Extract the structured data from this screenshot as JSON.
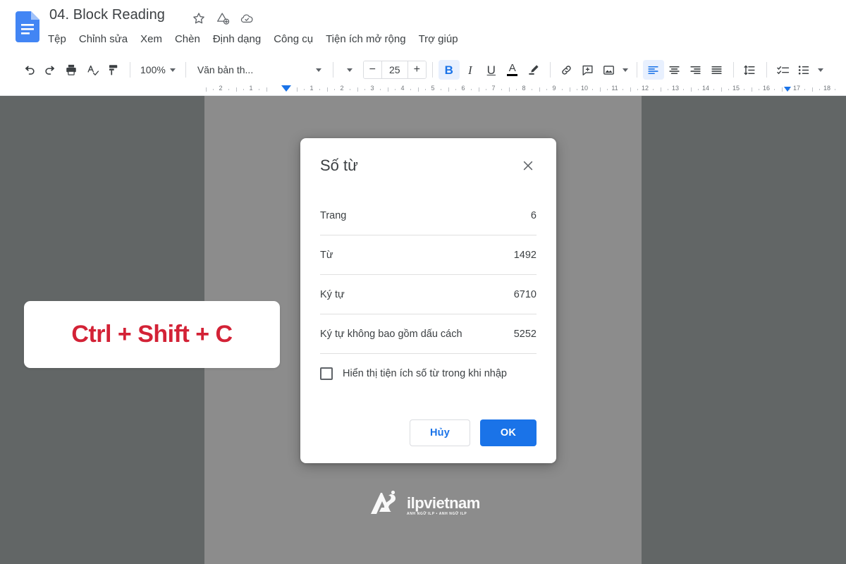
{
  "app": {
    "doc_title": "04. Block Reading",
    "doc_icon": "google-docs-icon"
  },
  "title_actions": [
    {
      "name": "star-icon",
      "label": "Gắn dấu sao"
    },
    {
      "name": "move-to-folder-icon",
      "label": "Di chuyển"
    },
    {
      "name": "cloud-saved-icon",
      "label": "Đã lưu vào Drive"
    }
  ],
  "menubar": {
    "items": [
      {
        "label": "Tệp"
      },
      {
        "label": "Chỉnh sửa"
      },
      {
        "label": "Xem"
      },
      {
        "label": "Chèn"
      },
      {
        "label": "Định dạng"
      },
      {
        "label": "Công cụ"
      },
      {
        "label": "Tiện ích mở rộng"
      },
      {
        "label": "Trợ giúp"
      }
    ]
  },
  "toolbar": {
    "zoom_level": "100%",
    "paragraph_style": "Văn bản th...",
    "font_size": "25",
    "decrease_label": "−",
    "increase_label": "+",
    "bold_label": "B",
    "italic_label": "I",
    "underline_label": "U",
    "text_color_label": "A",
    "icons": [
      "undo-icon",
      "redo-icon",
      "print-icon",
      "spellcheck-icon",
      "paint-format-icon",
      "insert-link-icon",
      "add-comment-icon",
      "insert-image-icon",
      "align-left-icon",
      "align-center-icon",
      "align-right-icon",
      "align-justify-icon",
      "line-spacing-icon",
      "checklist-icon",
      "bulleted-list-icon",
      "highlight-color-icon"
    ],
    "active": [
      "bold",
      "align-left"
    ]
  },
  "ruler": {
    "left_numbers": [
      "2",
      "1"
    ],
    "numbers": [
      "1",
      "2",
      "3",
      "4",
      "5",
      "6",
      "7",
      "8",
      "9",
      "10",
      "11",
      "12",
      "13",
      "14",
      "15",
      "16",
      "17",
      "18"
    ],
    "left_indent_marker": true,
    "right_indent_marker": true
  },
  "callout": {
    "shortcut": "Ctrl + Shift + C",
    "color": "#d32236"
  },
  "watermark": {
    "name": "ilpvietnam",
    "tagline": "ANH NGỮ ILP  •  ANH NGỮ ILP",
    "logo": "ilp-logo-icon"
  },
  "dialog": {
    "title": "Số từ",
    "close_label": "×",
    "rows": [
      {
        "label": "Trang",
        "value": "6"
      },
      {
        "label": "Từ",
        "value": "1492"
      },
      {
        "label": "Ký tự",
        "value": "6710"
      },
      {
        "label": "Ký tự không bao gồm dấu cách",
        "value": "5252"
      }
    ],
    "checkbox": {
      "label": "Hiển thị tiện ích số từ trong khi nhập",
      "checked": false
    },
    "cancel_label": "Hủy",
    "ok_label": "OK",
    "accent_color": "#1a73e8"
  },
  "colors": {
    "chrome_bg": "#ffffff",
    "outer_canvas": "#626666",
    "page_canvas": "#8c8c8c",
    "accent_blue": "#1a73e8",
    "callout_red": "#d32236"
  }
}
